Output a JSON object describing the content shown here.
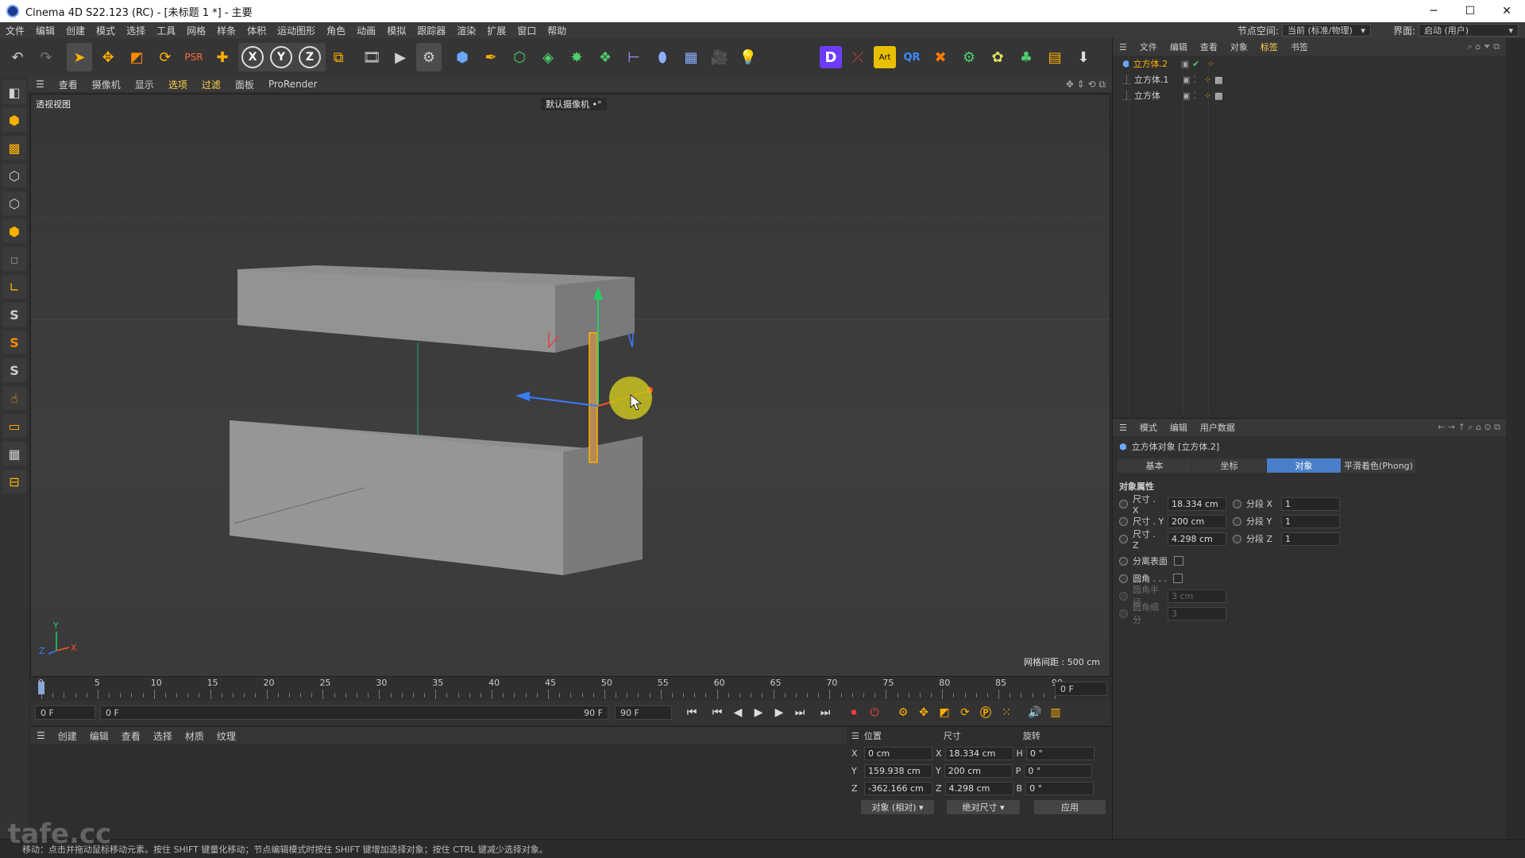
{
  "window": {
    "title": "Cinema 4D S22.123 (RC) - [未标题 1 *] - 主要",
    "controls": [
      "─",
      "☐",
      "✕"
    ]
  },
  "menubar": {
    "items": [
      "文件",
      "编辑",
      "创建",
      "模式",
      "选择",
      "工具",
      "网格",
      "样条",
      "体积",
      "运动图形",
      "角色",
      "动画",
      "模拟",
      "跟踪器",
      "渲染",
      "扩展",
      "窗口",
      "帮助"
    ],
    "node_space_label": "节点空间:",
    "node_space_value": "当前 (标准/物理)",
    "layout_label": "界面:",
    "layout_value": "启动 (用户)"
  },
  "toolbar": {
    "axis_x": "X",
    "axis_y": "Y",
    "axis_z": "Z"
  },
  "viewport": {
    "menu": [
      "查看",
      "摄像机",
      "显示",
      "选项",
      "过滤",
      "面板",
      "ProRender"
    ],
    "view_name": "透视视图",
    "camera": "默认摄像机 •°",
    "grid_spacing": "网格间距 : 500 cm",
    "axis_labels": {
      "x": "X",
      "y": "Y",
      "z": "Z"
    }
  },
  "timeline": {
    "ticks": [
      "0",
      "5",
      "10",
      "15",
      "20",
      "25",
      "30",
      "35",
      "40",
      "45",
      "50",
      "55",
      "60",
      "65",
      "70",
      "75",
      "80",
      "85",
      "90"
    ],
    "current_frame_right": "0 F",
    "start_field": "0 F",
    "range_start": "0 F",
    "range_end": "90 F",
    "end_field": "90 F"
  },
  "material_panel": {
    "menu": [
      "创建",
      "编辑",
      "查看",
      "选择",
      "材质",
      "纹理"
    ]
  },
  "coord_panel": {
    "headers": [
      "位置",
      "尺寸",
      "旋转"
    ],
    "rows": [
      {
        "axis": "X",
        "pos": "0 cm",
        "size_axis": "X",
        "size": "18.334 cm",
        "rot_axis": "H",
        "rot": "0 °"
      },
      {
        "axis": "Y",
        "pos": "159.938 cm",
        "size_axis": "Y",
        "size": "200 cm",
        "rot_axis": "P",
        "rot": "0 °"
      },
      {
        "axis": "Z",
        "pos": "-362.166 cm",
        "size_axis": "Z",
        "size": "4.298 cm",
        "rot_axis": "B",
        "rot": "0 °"
      }
    ],
    "mode_select": "对象 (相对)",
    "size_select": "绝对尺寸",
    "apply_label": "应用"
  },
  "object_manager": {
    "menu": [
      "文件",
      "编辑",
      "查看",
      "对象",
      "标签",
      "书签"
    ],
    "objects": [
      {
        "name": "立方体.2",
        "selected": true
      },
      {
        "name": "立方体.1",
        "selected": false
      },
      {
        "name": "立方体",
        "selected": false
      }
    ]
  },
  "attribute_manager": {
    "menu": [
      "模式",
      "编辑",
      "用户数据"
    ],
    "object_title": "立方体对象 [立方体.2]",
    "tabs": [
      "基本",
      "坐标",
      "对象",
      "平滑着色(Phong)"
    ],
    "active_tab": "对象",
    "section_title": "对象属性",
    "size_rows": [
      {
        "label": "尺寸 . X",
        "value": "18.334 cm",
        "seg_label": "分段 X",
        "seg_value": "1"
      },
      {
        "label": "尺寸 . Y",
        "value": "200 cm",
        "seg_label": "分段 Y",
        "seg_value": "1"
      },
      {
        "label": "尺寸 . Z",
        "value": "4.298 cm",
        "seg_label": "分段 Z",
        "seg_value": "1"
      }
    ],
    "separate_surfaces": "分离表面",
    "fillet": "圆角 . . .",
    "fillet_radius_label": "圆角半径",
    "fillet_radius_value": "3 cm",
    "fillet_subdiv_label": "圆角细分",
    "fillet_subdiv_value": "3"
  },
  "statusbar": {
    "text": "移动：点击并拖动鼠标移动元素。按住 SHIFT 键量化移动；节点编辑模式时按住 SHIFT 键增加选择对象；按住 CTRL 键减少选择对象。"
  },
  "watermark": "tafe.cc"
}
